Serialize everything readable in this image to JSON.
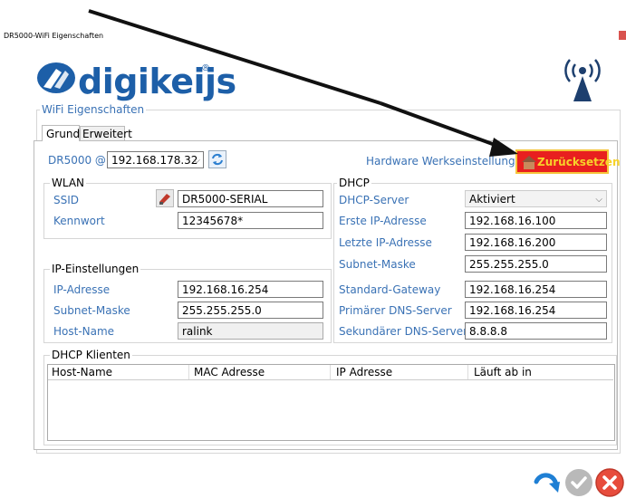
{
  "window": {
    "title": "DR5000-WiFi Eigenschaften"
  },
  "brand": {
    "logo_text": "digikeijs",
    "registered": "®",
    "accent": "#1d5fa8"
  },
  "group_main": {
    "legend": "WiFi Eigenschaften"
  },
  "tabs": [
    {
      "label": "Grund",
      "active": true
    },
    {
      "label": "Erweitert",
      "active": false
    }
  ],
  "device": {
    "label": "DR5000 @",
    "ip_value": "192.168.178.32",
    "factory_reset_label": "Hardware Werkseinstellungen",
    "reset_button": "Zurücksetzen",
    "reset_color": "#e81f1f"
  },
  "wlan": {
    "legend": "WLAN",
    "ssid_label": "SSID",
    "ssid_value": "DR5000-SERIAL",
    "password_label": "Kennwort",
    "password_value": "12345678*"
  },
  "ip_settings": {
    "legend": "IP-Einstellungen",
    "ip_label": "IP-Adresse",
    "ip_value": "192.168.16.254",
    "subnet_label": "Subnet-Maske",
    "subnet_value": "255.255.255.0",
    "host_label": "Host-Name",
    "host_value": "ralink"
  },
  "dhcp": {
    "legend": "DHCP",
    "server_label": "DHCP-Server",
    "server_value": "Aktiviert",
    "first_ip_label": "Erste IP-Adresse",
    "first_ip_value": "192.168.16.100",
    "last_ip_label": "Letzte IP-Adresse",
    "last_ip_value": "192.168.16.200",
    "subnet_label": "Subnet-Maske",
    "subnet_value": "255.255.255.0",
    "gateway_label": "Standard-Gateway",
    "gateway_value": "192.168.16.254",
    "dns1_label": "Primärer DNS-Server",
    "dns1_value": "192.168.16.254",
    "dns2_label": "Sekundärer DNS-Server",
    "dns2_value": "8.8.8.8"
  },
  "dhcp_clients": {
    "legend": "DHCP Klienten",
    "columns": [
      "Host-Name",
      "MAC Adresse",
      "IP Adresse",
      "Läuft ab in"
    ]
  },
  "icons": {
    "wifi": "wifi-tower-icon",
    "refresh": "refresh-icon",
    "ssid_tool": "ssid-tool-icon",
    "undo": "undo-icon",
    "ok": "ok-icon",
    "cancel": "cancel-icon"
  }
}
